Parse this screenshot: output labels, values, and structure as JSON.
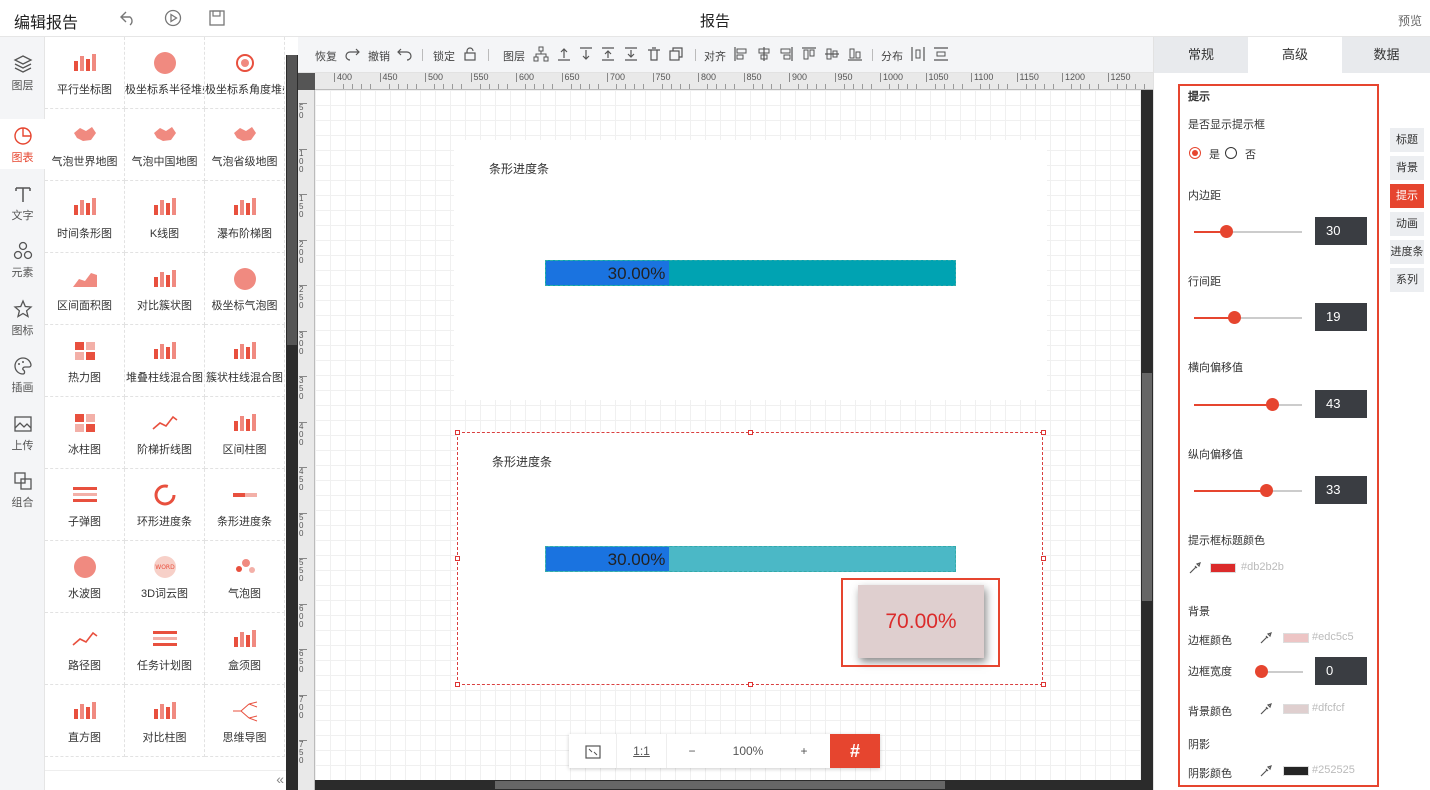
{
  "app": {
    "title": "编辑报告",
    "page_title": "报告",
    "preview": "预览"
  },
  "leftnav": [
    {
      "label": "图层",
      "icon": "layers-icon"
    },
    {
      "label": "图表",
      "icon": "pie-chart-icon",
      "active": true
    },
    {
      "label": "文字",
      "icon": "text-icon"
    },
    {
      "label": "元素",
      "icon": "shapes-icon"
    },
    {
      "label": "图标",
      "icon": "star-icon"
    },
    {
      "label": "插画",
      "icon": "palette-icon"
    },
    {
      "label": "上传",
      "icon": "image-upload-icon"
    },
    {
      "label": "组合",
      "icon": "group-icon"
    }
  ],
  "palette": [
    "平行坐标图",
    "极坐标系半径堆叠",
    "极坐标系角度堆叠",
    "气泡世界地图",
    "气泡中国地图",
    "气泡省级地图",
    "时间条形图",
    "K线图",
    "瀑布阶梯图",
    "区间面积图",
    "对比簇状图",
    "极坐标气泡图",
    "热力图",
    "堆叠柱线混合图",
    "簇状柱线混合图",
    "冰柱图",
    "阶梯折线图",
    "区间柱图",
    "子弹图",
    "环形进度条",
    "条形进度条",
    "水波图",
    "3D词云图",
    "气泡图",
    "路径图",
    "任务计划图",
    "盒须图",
    "直方图",
    "对比柱图",
    "思维导图"
  ],
  "palette_collapse": "«",
  "toolbar": {
    "restore": "恢复",
    "undo": "撤销",
    "lock": "锁定",
    "layer": "图层",
    "align": "对齐",
    "distribute": "分布"
  },
  "ruler_top": [
    "400",
    "450",
    "500",
    "550",
    "600",
    "650",
    "700",
    "750",
    "800",
    "850",
    "900",
    "950",
    "1000",
    "1050",
    "1100",
    "1150",
    "1200",
    "1250"
  ],
  "ruler_left": [
    "50",
    "100",
    "150",
    "200",
    "250",
    "300",
    "350",
    "400",
    "450",
    "500",
    "550",
    "600",
    "650",
    "700",
    "750"
  ],
  "widgets": [
    {
      "title": "条形进度条",
      "progress_label": "30.00%",
      "progress": 0.3,
      "track_color": "#00a3b2",
      "fill_color": "#1a73e0"
    },
    {
      "title": "条形进度条",
      "progress_label": "30.00%",
      "progress": 0.3,
      "track_color": "#4bb8c6",
      "fill_color": "#1a73e0"
    }
  ],
  "tooltip": {
    "text": "70.00%"
  },
  "zoom": {
    "fit": "⤢",
    "one_to_one": "1:1",
    "minus": "−",
    "level": "100%",
    "plus": "+",
    "grid": "#"
  },
  "right_tabs": [
    "常规",
    "高级",
    "数据"
  ],
  "right_tab_active": 1,
  "side_tabs": [
    "标题",
    "背景",
    "提示",
    "动画",
    "进度条",
    "系列"
  ],
  "side_tab_active": 2,
  "props": {
    "section": "提示",
    "show_tooltip_label": "是否显示提示框",
    "yes": "是",
    "no": "否",
    "show": "yes",
    "padding": {
      "label": "内边距",
      "value": "30",
      "level": 0.3
    },
    "line_height": {
      "label": "行间距",
      "value": "19",
      "level": 0.37
    },
    "offset_x": {
      "label": "横向偏移值",
      "value": "43",
      "level": 0.72
    },
    "offset_y": {
      "label": "纵向偏移值",
      "value": "33",
      "level": 0.67
    },
    "title_color": {
      "label": "提示框标题颜色",
      "value": "#db2b2b",
      "hex": "#db2b2b"
    },
    "bg_section": "背景",
    "border_color": {
      "label": "边框颜色",
      "value": "#edc5c5",
      "hex": "#edc5c5"
    },
    "border_width": {
      "label": "边框宽度",
      "value": "0",
      "level": 0.0
    },
    "bg_color": {
      "label": "背景颜色",
      "value": "#dfcfcf",
      "hex": "#dfcfcf"
    },
    "shadow_section": "阴影",
    "shadow_color": {
      "label": "阴影颜色",
      "value": "#252525",
      "hex": "#252525"
    }
  }
}
